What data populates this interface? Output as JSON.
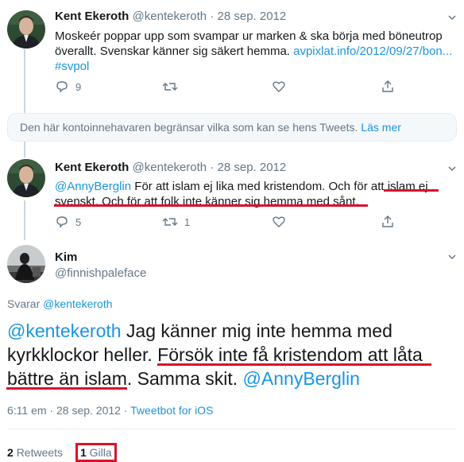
{
  "tweet1": {
    "name": "Kent Ekeroth",
    "handle": "@kentekeroth",
    "date": "28 sep. 2012",
    "line1": "Moskeér poppar upp som svampar ur marken & ska börja med böneutrop",
    "line2_text": "överallt. Svenskar känner sig säkert hemma. ",
    "line2_link": "avpixlat.info/2012/09/27/bon...",
    "hashtag": "#svpol",
    "reply_count": "9"
  },
  "notice": {
    "text": "Den här kontoinnehavaren begränsar vilka som kan se hens Tweets.",
    "link": "Läs mer"
  },
  "tweet2": {
    "name": "Kent Ekeroth",
    "handle": "@kentekeroth",
    "date": "28 sep. 2012",
    "mention": "@AnnyBerglin",
    "line1_rest": " För att islam ej lika med kristendom. Och för att islam ej",
    "line2": "svenskt. Och för att folk inte känner sig hemma med sånt.",
    "reply_count": "5",
    "retweet_count": "1"
  },
  "tweet3": {
    "name": "Kim",
    "handle": "@finnishpaleface",
    "replying_prefix": "Svarar ",
    "replying_to": "@kentekeroth",
    "mention1": "@kentekeroth",
    "line1_rest": " Jag känner mig inte hemma med",
    "line2": "kyrkklockor heller. Försök inte få kristendom att låta",
    "line3_a": "bättre än islam. Samma skit. ",
    "mention2": "@AnnyBerglin",
    "time_date": "6:11 em · 28 sep. 2012 · ",
    "client": "Tweetbot for iOS",
    "retweets_count": "2",
    "retweets_label": "Retweets",
    "likes_count": "1",
    "likes_label": "Gilla"
  },
  "colors": {
    "accent": "#1b95e0",
    "muted": "#657786",
    "highlight": "#d8142b"
  },
  "icons": [
    "reply-icon",
    "retweet-icon",
    "like-icon",
    "share-icon",
    "chevron-down-icon"
  ]
}
